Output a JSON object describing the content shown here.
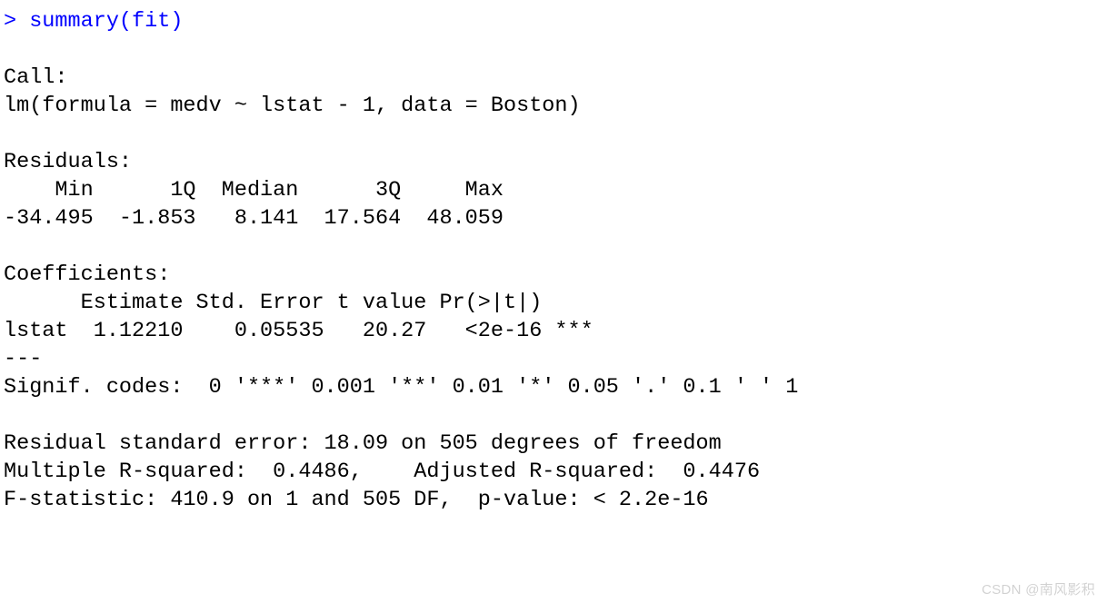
{
  "prompt_line": "> summary(fit)",
  "blank": " ",
  "call_header": "Call:",
  "call_formula": "lm(formula = medv ~ lstat - 1, data = Boston)",
  "residuals_header": "Residuals:",
  "residuals_names": "    Min      1Q  Median      3Q     Max ",
  "residuals_values": "-34.495  -1.853   8.141  17.564  48.059 ",
  "coef_header": "Coefficients:",
  "coef_cols": "      Estimate Std. Error t value Pr(>|t|)    ",
  "coef_row": "lstat  1.12210    0.05535   20.27   <2e-16 ***",
  "rule": "---",
  "signif": "Signif. codes:  0 '***' 0.001 '**' 0.01 '*' 0.05 '.' 0.1 ' ' 1",
  "rse": "Residual standard error: 18.09 on 505 degrees of freedom",
  "r2": "Multiple R-squared:  0.4486,\tAdjusted R-squared:  0.4476 ",
  "fstat": "F-statistic: 410.9 on 1 and 505 DF,  p-value: < 2.2e-16",
  "watermark": "CSDN @南风影积"
}
